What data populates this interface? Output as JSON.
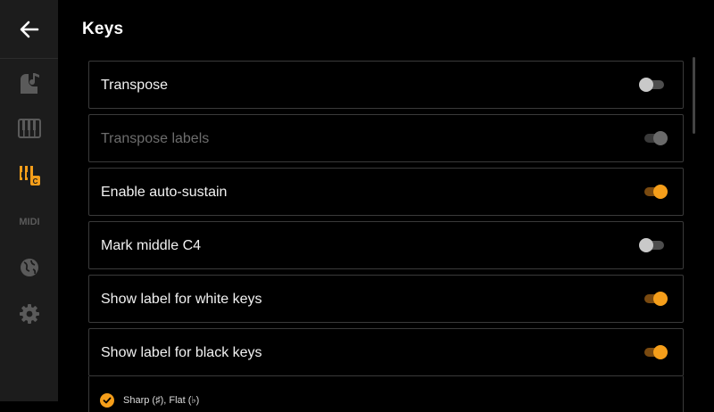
{
  "header": {
    "title": "Keys"
  },
  "sidebar": {
    "items": [
      {
        "icon": "piano-note-icon",
        "selected": false
      },
      {
        "icon": "piano-keyboard-icon",
        "selected": false
      },
      {
        "icon": "keys-label-icon",
        "selected": true,
        "badge": "C"
      },
      {
        "icon": "midi-icon",
        "selected": false,
        "text": "MIDI"
      },
      {
        "icon": "globe-icon",
        "selected": false
      },
      {
        "icon": "gear-icon",
        "selected": false
      }
    ]
  },
  "settings": [
    {
      "label": "Transpose",
      "state": "off",
      "enabled": true
    },
    {
      "label": "Transpose labels",
      "state": "on",
      "enabled": false
    },
    {
      "label": "Enable auto-sustain",
      "state": "on",
      "enabled": true
    },
    {
      "label": "Mark middle C4",
      "state": "off",
      "enabled": true
    },
    {
      "label": "Show label for white keys",
      "state": "on",
      "enabled": true
    },
    {
      "label": "Show label for black keys",
      "state": "on",
      "enabled": true
    }
  ],
  "black_key_option": {
    "label": "Sharp (♯), Flat (♭)",
    "checked": true
  },
  "colors": {
    "accent": "#f59e1a",
    "sidebar_bg": "#1c1c1c",
    "background": "#000000"
  }
}
